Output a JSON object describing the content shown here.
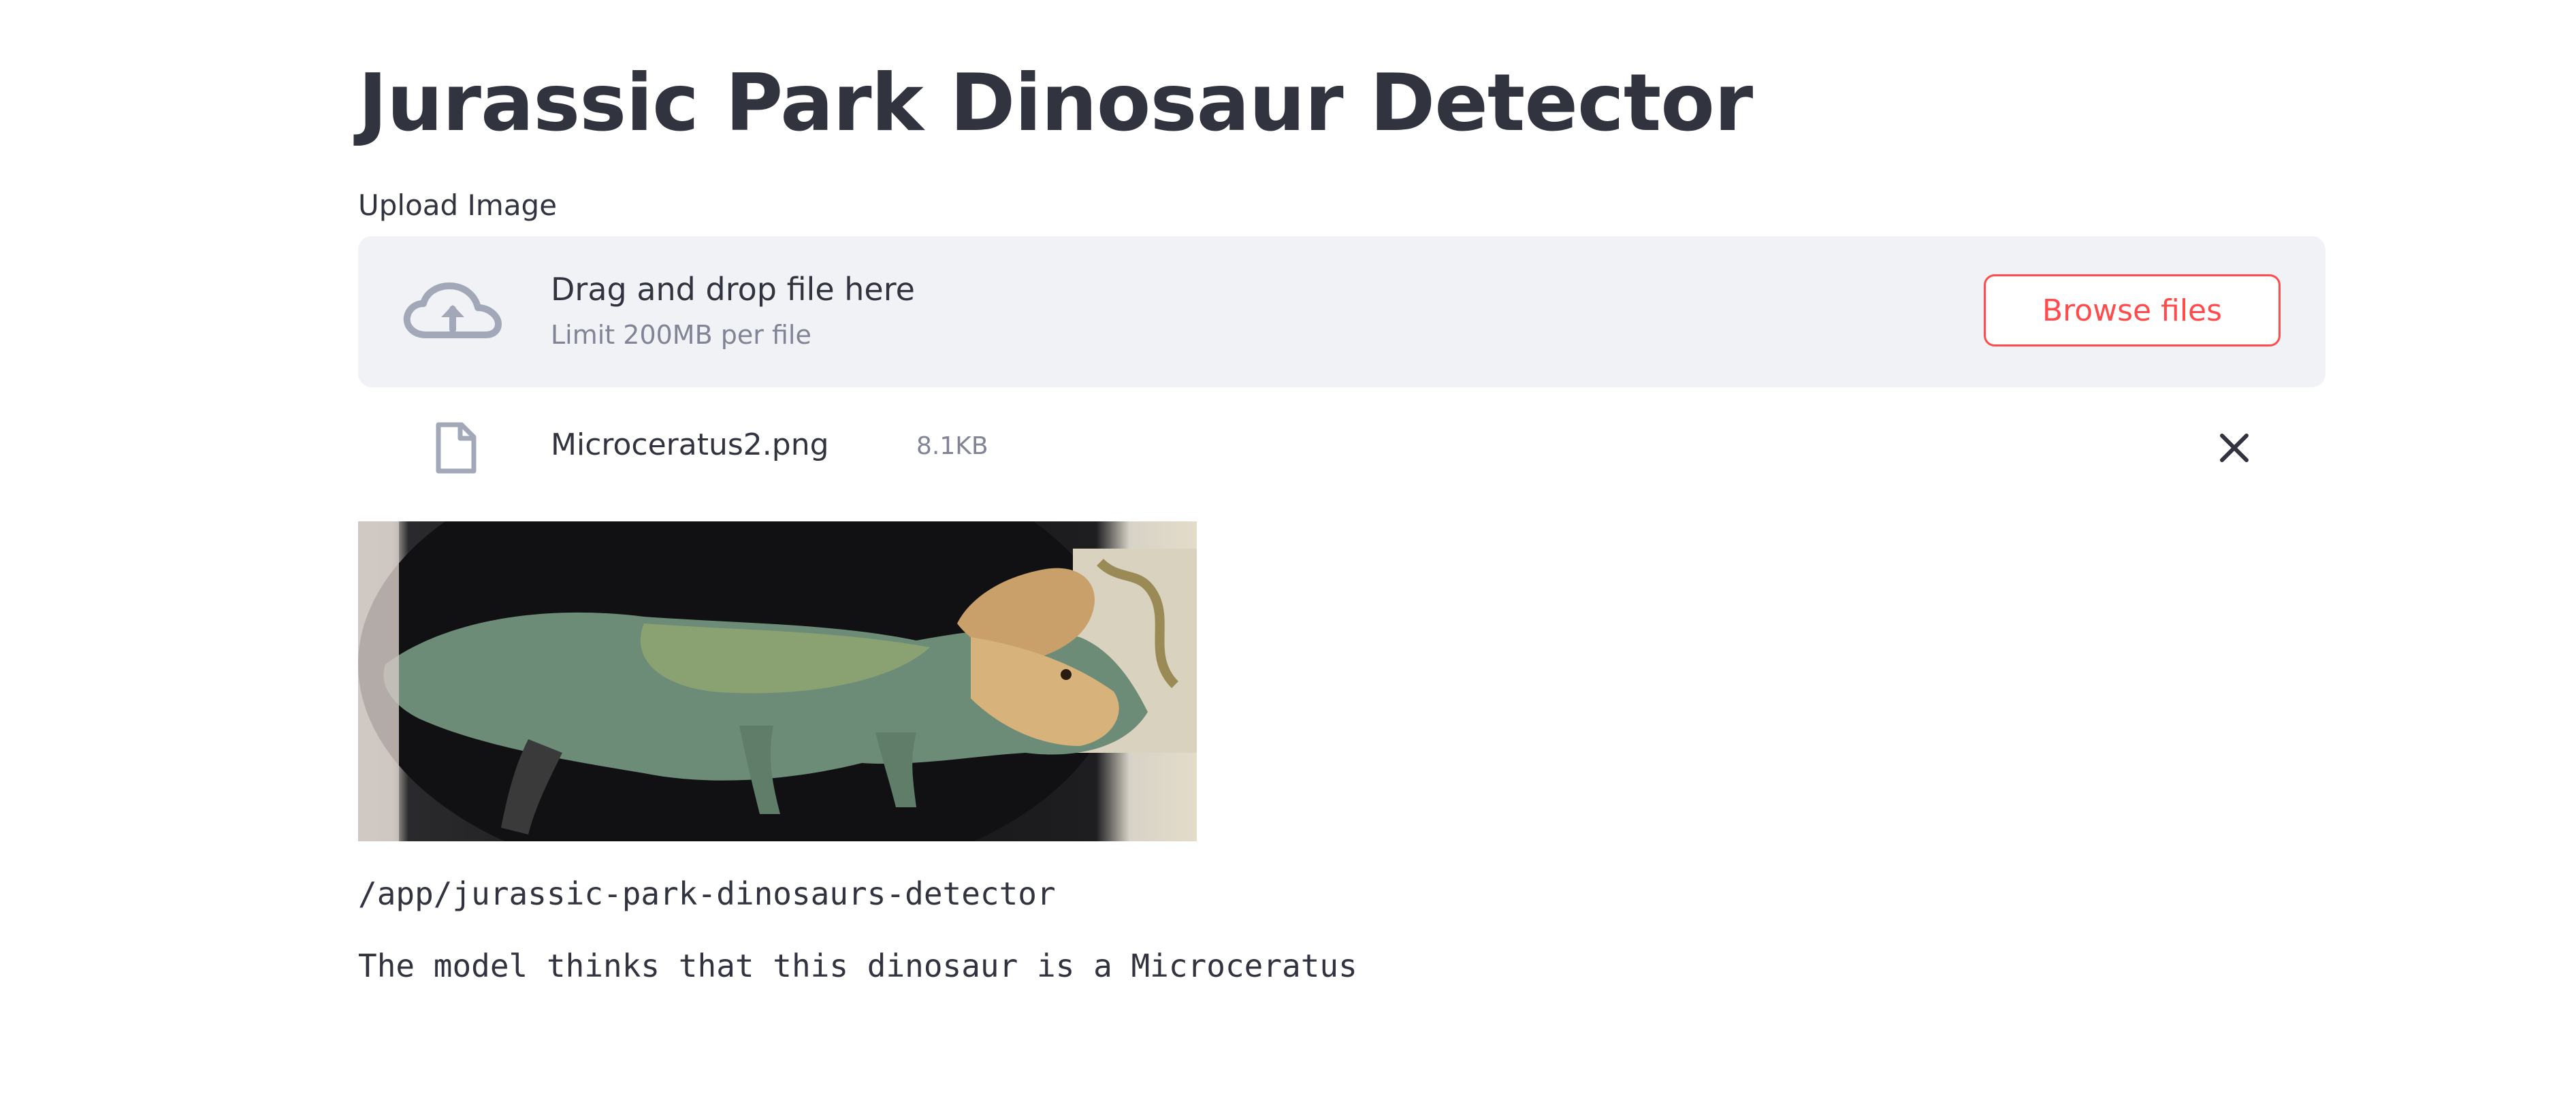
{
  "page": {
    "title": "Jurassic Park Dinosaur Detector"
  },
  "uploader": {
    "label": "Upload Image",
    "drag_text": "Drag and drop file here",
    "limit_text": "Limit 200MB per file",
    "browse_label": "Browse files",
    "icon": "cloud-upload-icon"
  },
  "uploaded_file": {
    "name": "Microceratus2.png",
    "size": "8.1KB",
    "icon": "file-icon",
    "remove_icon": "close-icon"
  },
  "image": {
    "alt": "Uploaded dinosaur image"
  },
  "output": {
    "path": "/app/jurassic-park-dinosaurs-detector",
    "prediction": "The model thinks that this dinosaur is a Microceratus"
  },
  "colors": {
    "accent": "#ff4b4b",
    "text": "#31333f",
    "muted": "#808495",
    "dropzone_bg": "#f0f2f6"
  }
}
